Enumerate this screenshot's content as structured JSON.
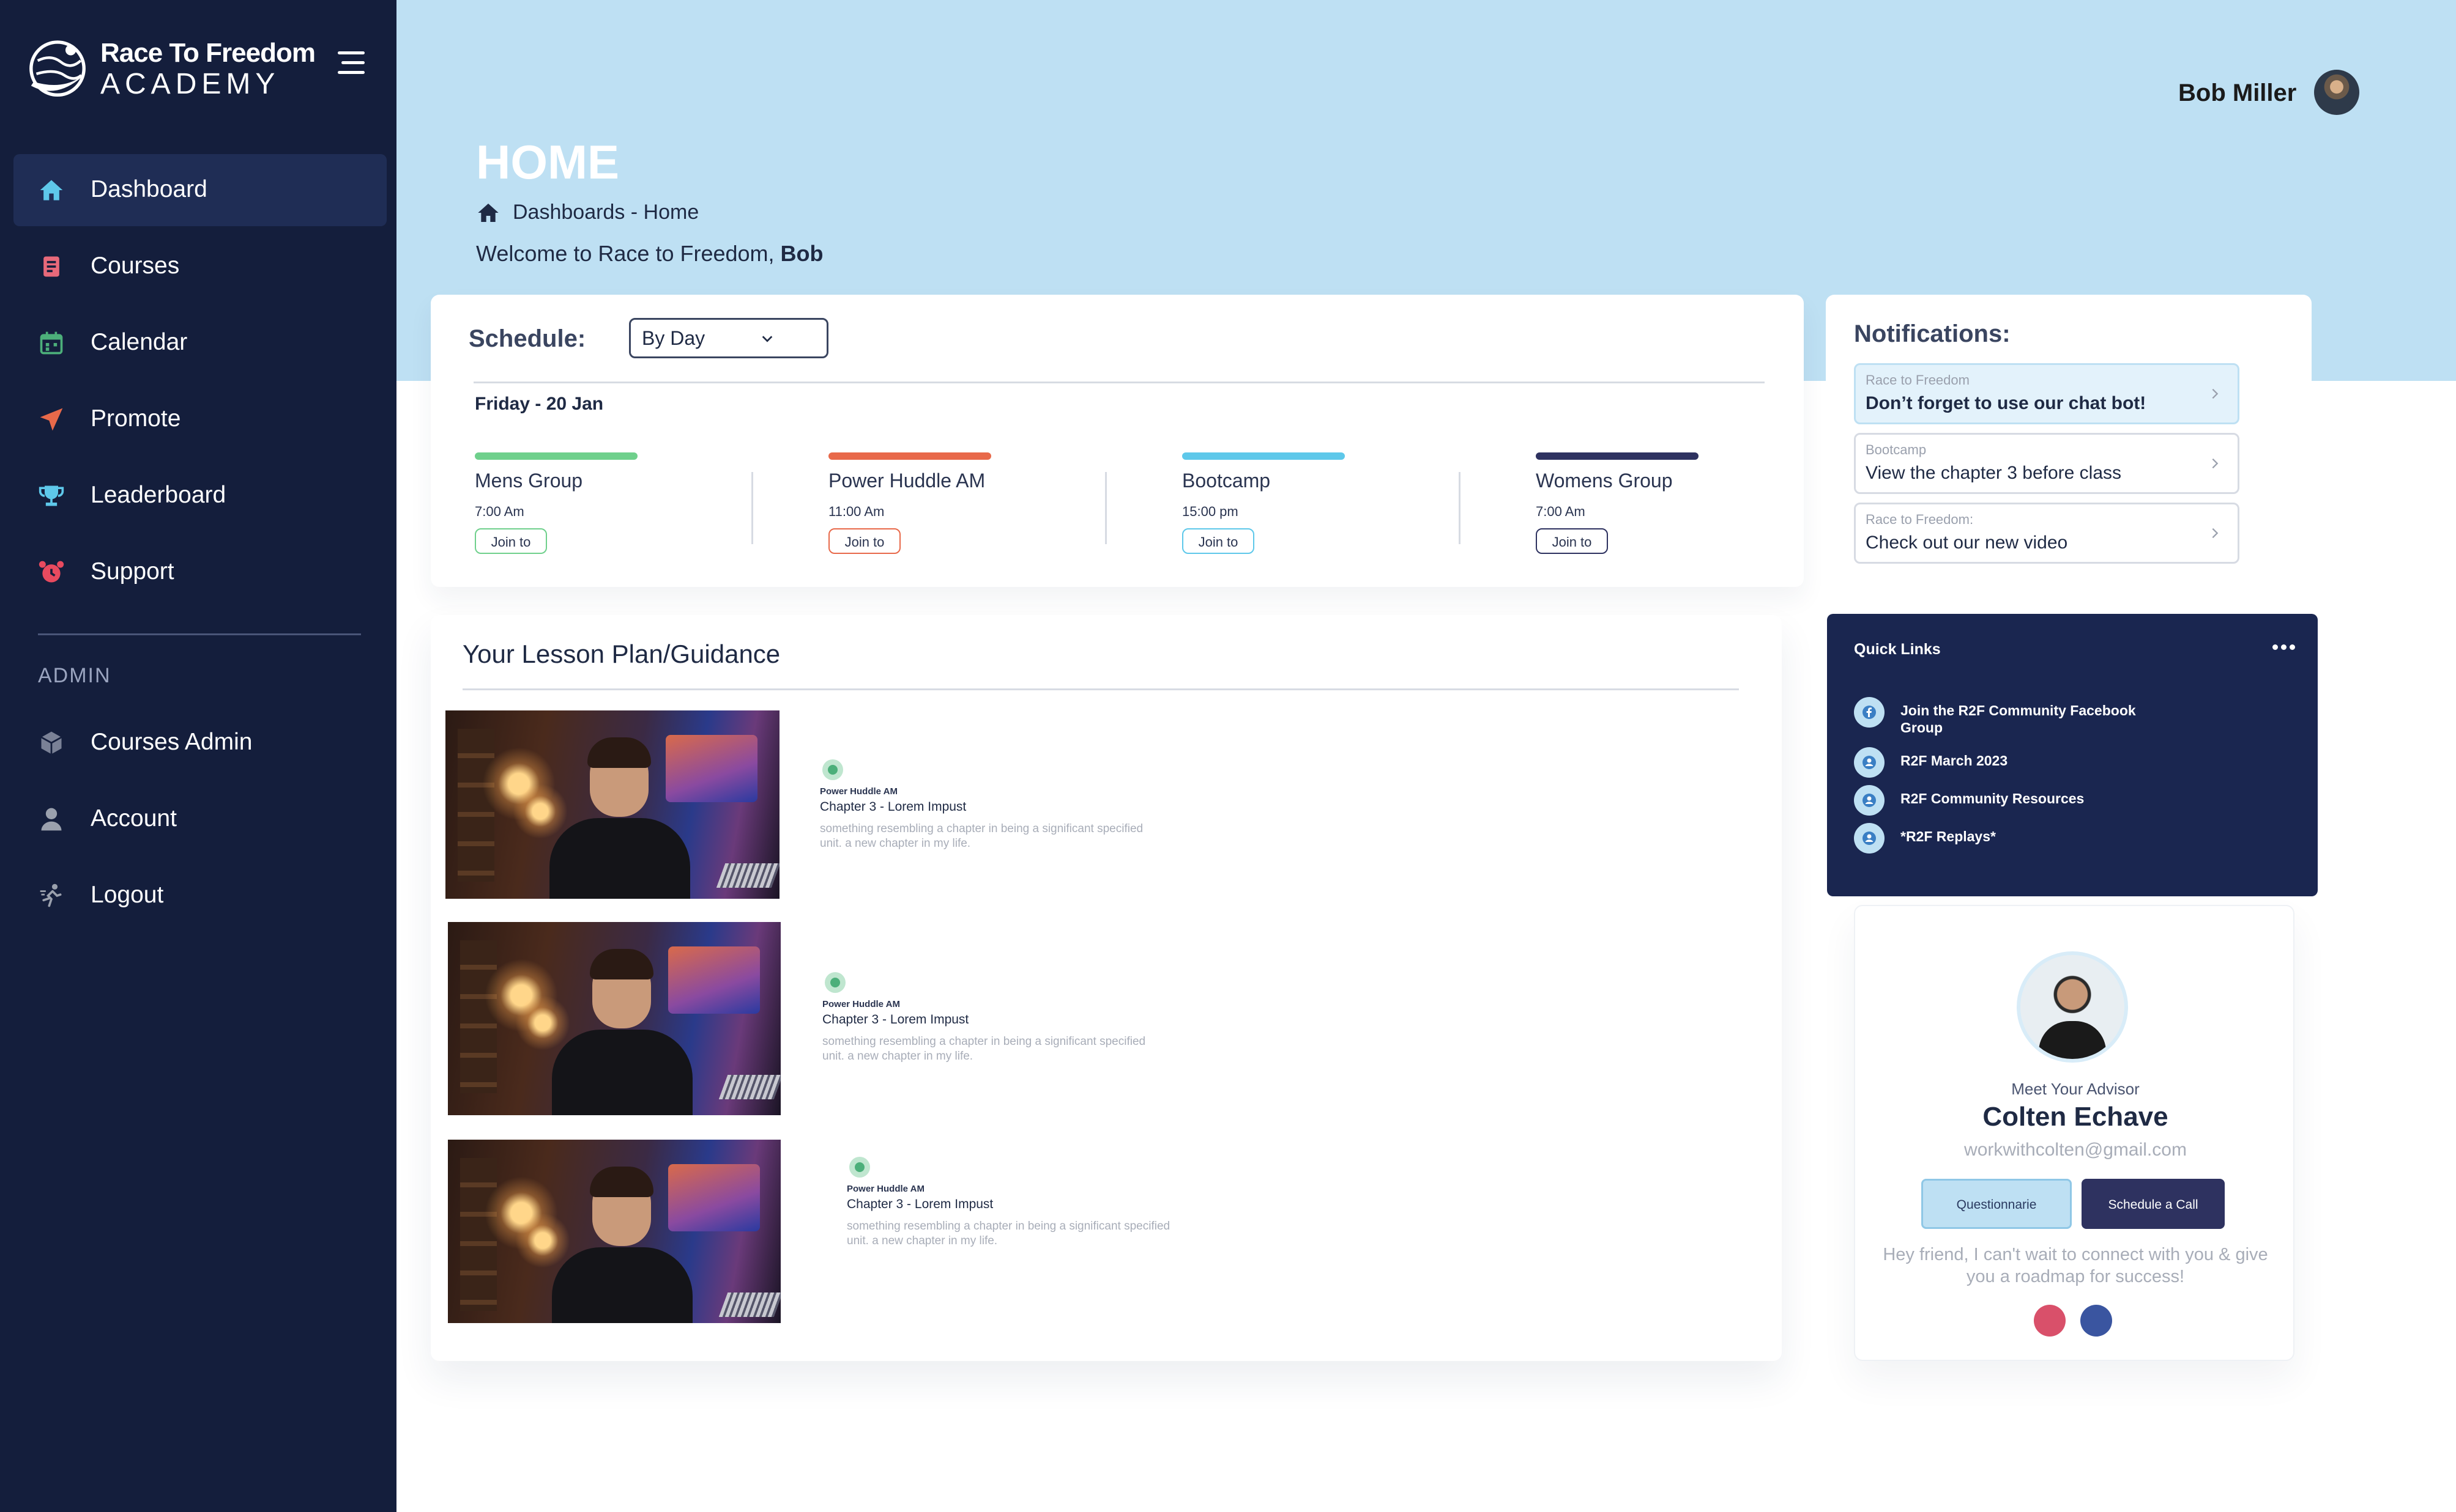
{
  "brand": {
    "name_line1": "Race To Freedom",
    "name_line2": "ACADEMY"
  },
  "sidebar": {
    "items": [
      {
        "label": "Dashboard",
        "icon": "home-icon",
        "active": true
      },
      {
        "label": "Courses",
        "icon": "book-icon"
      },
      {
        "label": "Calendar",
        "icon": "calendar-icon"
      },
      {
        "label": "Promote",
        "icon": "send-icon"
      },
      {
        "label": "Leaderboard",
        "icon": "trophy-icon"
      },
      {
        "label": "Support",
        "icon": "alarm-clock-icon"
      }
    ],
    "admin_label": "ADMIN",
    "admin_items": [
      {
        "label": "Courses Admin",
        "icon": "box-icon"
      },
      {
        "label": "Account",
        "icon": "user-icon"
      },
      {
        "label": "Logout",
        "icon": "runner-icon"
      }
    ]
  },
  "header": {
    "user_name": "Bob Miller",
    "title": "HOME",
    "breadcrumb": "Dashboards - Home",
    "welcome_prefix": "Welcome to Race to Freedom, ",
    "welcome_name": "Bob"
  },
  "schedule": {
    "label": "Schedule:",
    "view_select": "By Day",
    "date": "Friday - 20 Jan",
    "events": [
      {
        "name": "Mens Group",
        "time": "7:00 Am",
        "join": "Join to",
        "color": "#6fd08c"
      },
      {
        "name": "Power Huddle AM",
        "time": "11:00 Am",
        "join": "Join to",
        "color": "#e8694a"
      },
      {
        "name": "Bootcamp",
        "time": "15:00 pm",
        "join": "Join to",
        "color": "#5ec8ea"
      },
      {
        "name": "Womens Group",
        "time": "7:00 Am",
        "join": "Join to",
        "color": "#2e3260"
      }
    ]
  },
  "lessons": {
    "title": "Your Lesson Plan/Guidance",
    "items": [
      {
        "group": "Power Huddle AM",
        "chapter": "Chapter 3 - Lorem Impust",
        "desc": "something resembling a chapter in being a significant specified unit. a new chapter in my life."
      },
      {
        "group": "Power Huddle AM",
        "chapter": "Chapter 3 - Lorem Impust",
        "desc": "something resembling a chapter in being a significant specified unit. a new chapter in my life."
      },
      {
        "group": "Power Huddle AM",
        "chapter": "Chapter 3 - Lorem Impust",
        "desc": "something resembling a chapter in being a significant specified unit. a new chapter in my life."
      }
    ]
  },
  "notifications": {
    "title": "Notifications:",
    "items": [
      {
        "source": "Race to Freedom",
        "message": "Don’t forget to use our chat bot!"
      },
      {
        "source": "Bootcamp",
        "message": "View the chapter 3 before class"
      },
      {
        "source": "Race to Freedom:",
        "message": "Check out our new video"
      }
    ]
  },
  "quick_links": {
    "title": "Quick Links",
    "items": [
      {
        "label": "Join the R2F Community Facebook Group",
        "icon": "facebook-icon"
      },
      {
        "label": "R2F March 2023",
        "icon": "user-icon"
      },
      {
        "label": "R2F Community Resources",
        "icon": "user-icon"
      },
      {
        "label": "*R2F Replays*",
        "icon": "user-icon"
      }
    ]
  },
  "advisor": {
    "meet_label": "Meet Your Advisor",
    "name": "Colten Echave",
    "email": "workwithcolten@gmail.com",
    "questionnaire_label": "Questionnarie",
    "schedule_label": "Schedule a Call",
    "message": "Hey friend, I can't wait to connect with you & give you a roadmap for success!",
    "social_colors": [
      "#d9506a",
      "#3a55a0"
    ]
  },
  "colors": {
    "sidebar_bg": "#141e3c",
    "header_band": "#bee0f3",
    "accent_dark": "#2e3260"
  }
}
